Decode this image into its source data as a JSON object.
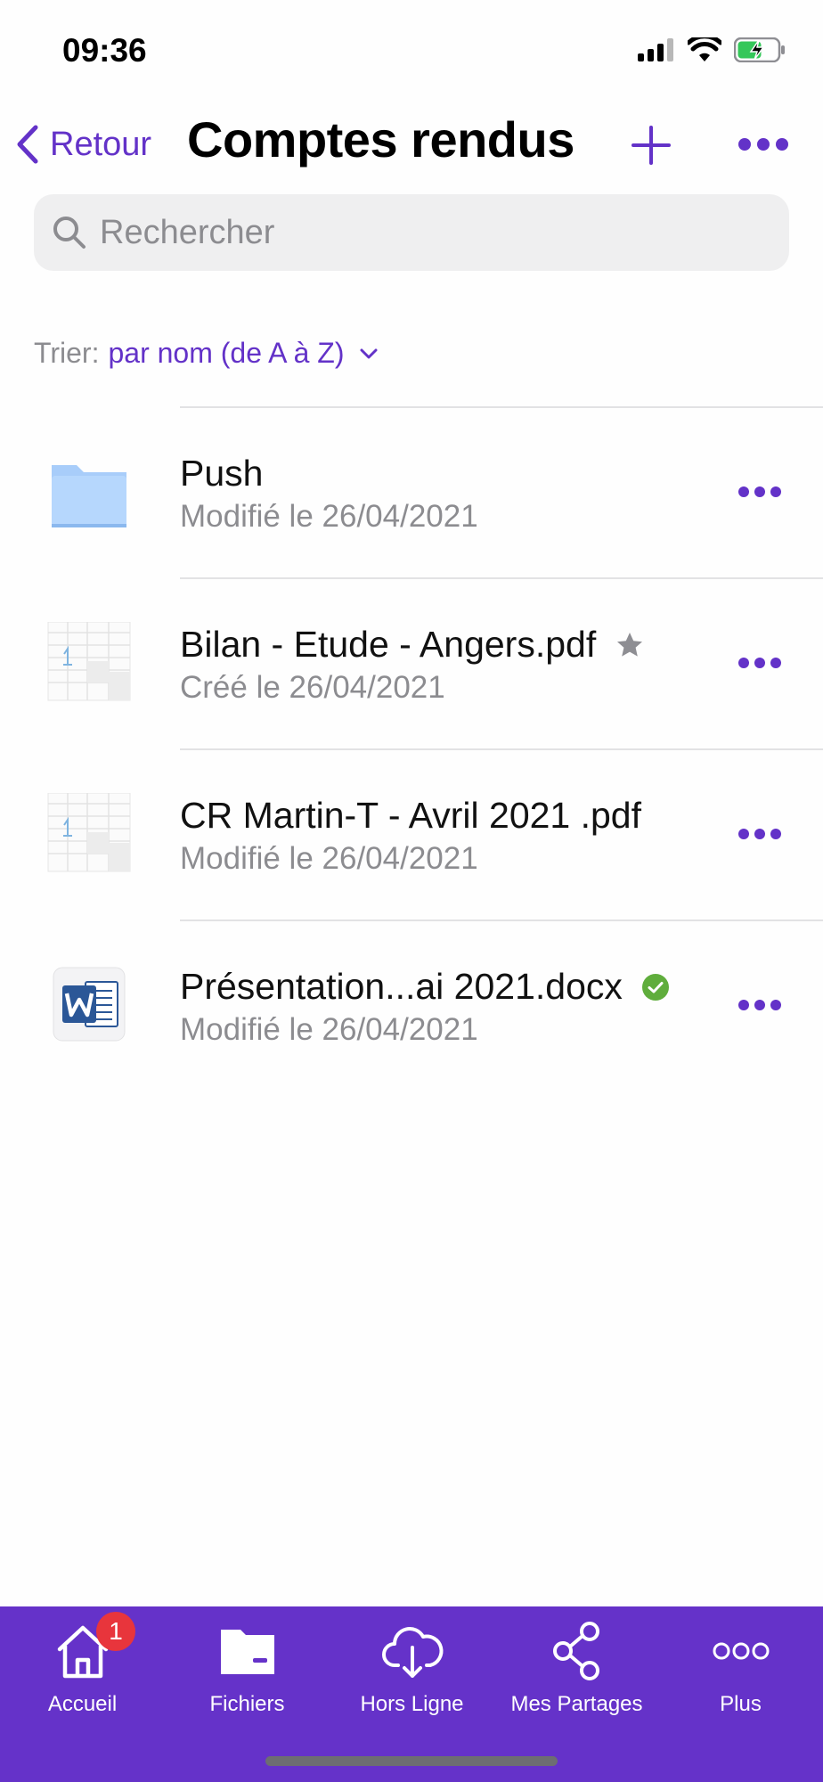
{
  "status_bar": {
    "time": "09:36"
  },
  "nav": {
    "back_label": "Retour",
    "title": "Comptes rendus"
  },
  "search": {
    "placeholder": "Rechercher"
  },
  "sort": {
    "label": "Trier:",
    "value": "par nom (de A à Z)"
  },
  "files": [
    {
      "name": "Push",
      "meta": "Modifié le 26/04/2021",
      "type": "folder",
      "badge": "none"
    },
    {
      "name": "Bilan - Etude - Angers.pdf",
      "meta": "Créé le 26/04/2021",
      "type": "pdf",
      "badge": "star"
    },
    {
      "name": "CR Martin-T - Avril 2021 .pdf",
      "meta": "Modifié le 26/04/2021",
      "type": "pdf",
      "badge": "none"
    },
    {
      "name": "Présentation...ai 2021.docx",
      "meta": "Modifié le 26/04/2021",
      "type": "word",
      "badge": "synced-check"
    }
  ],
  "tabbar": {
    "items": [
      {
        "label": "Accueil",
        "icon": "home-icon",
        "badge": "1"
      },
      {
        "label": "Fichiers",
        "icon": "folder-icon"
      },
      {
        "label": "Hors Ligne",
        "icon": "cloud-download-icon"
      },
      {
        "label": "Mes Partages",
        "icon": "share-icon"
      },
      {
        "label": "Plus",
        "icon": "more-circles-icon"
      }
    ]
  },
  "colors": {
    "accent": "#6332c8",
    "tabbar": "#6532c9",
    "badge": "#e8353c",
    "check": "#5fad3c",
    "star": "#8e8e93"
  }
}
